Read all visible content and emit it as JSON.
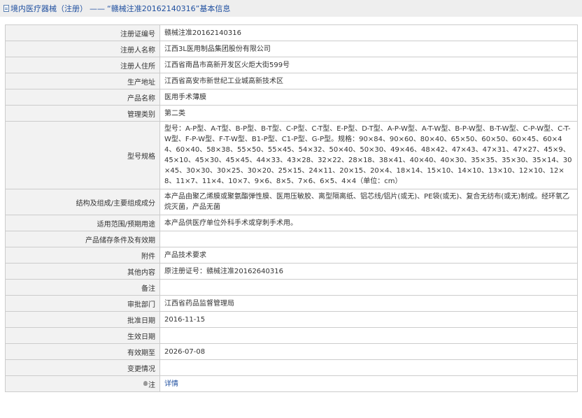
{
  "header": {
    "icon": "document-icon",
    "breadcrumb_link": "境内医疗器械（注册）",
    "separator": "——",
    "title": "“赣械注准20162140316”基本信息"
  },
  "rows": [
    {
      "label": "注册证编号",
      "value": "赣械注准20162140316"
    },
    {
      "label": "注册人名称",
      "value": "江西3L医用制品集团股份有限公司"
    },
    {
      "label": "注册人住所",
      "value": "江西省南昌市高新开发区火炬大街599号"
    },
    {
      "label": "生产地址",
      "value": "江西省高安市新世纪工业城高新技术区"
    },
    {
      "label": "产品名称",
      "value": "医用手术薄膜"
    },
    {
      "label": "管理类别",
      "value": "第二类"
    },
    {
      "label": "型号规格",
      "value": "型号：A-P型、A-T型、B-P型、B-T型、C-P型、C-T型、E-P型、D-T型、A-P-W型、A-T-W型、B-P-W型、B-T-W型、C-P-W型、C-T-W型、F-P-W型、F-T-W型、B1-P型、C1-P型、G-P型。规格：90×84、90×60、80×40、65×50、60×50、60×45、60×44、60×40、58×38、55×50、55×45、54×32、50×40、50×30、49×46、48×42、47×43、47×31、47×27、45×9、45×10、45×30、45×45、44×33、43×28、32×22、28×18、38×41、40×40、40×30、35×35、35×30、35×14、30×45、30×30、30×25、30×20、25×15、24×11、20×15、20×4、18×14、15×10、14×10、13×10、12×10、12×8、11×7、11×4、10×7、9×6、8×5、7×6、6×5、4×4（单位：cm）"
    },
    {
      "label": "结构及组成/主要组成成分",
      "value": "本产品由聚乙烯膜或聚氨酯弹性膜、医用压敏胶、离型隔离纸、铝芯线/铝片(或无)、PE袋(或无)、复合无纺布(或无)制成。经环氧乙烷灭菌，产品无菌"
    },
    {
      "label": "适用范围/预期用途",
      "value": "本产品供医疗单位外科手术或穿刺手术用。"
    },
    {
      "label": "产品储存条件及有效期",
      "value": ""
    },
    {
      "label": "附件",
      "value": "产品技术要求"
    },
    {
      "label": "其他内容",
      "value": "原注册证号：赣械注准20162640316"
    },
    {
      "label": "备注",
      "value": ""
    },
    {
      "label": "审批部门",
      "value": "江西省药品监督管理局"
    },
    {
      "label": "批准日期",
      "value": "2016-11-15"
    },
    {
      "label": "生效日期",
      "value": ""
    },
    {
      "label": "有效期至",
      "value": "2026-07-08"
    },
    {
      "label": "变更情况",
      "value": ""
    }
  ],
  "note_row": {
    "label": "注",
    "icon": "lightbulb-icon",
    "link": "详情"
  }
}
